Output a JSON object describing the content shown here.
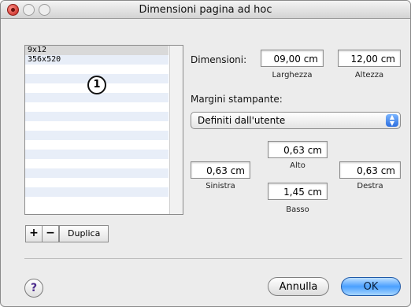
{
  "window": {
    "title": "Dimensioni pagina ad hoc"
  },
  "list": {
    "items": [
      "9x12",
      "356x520",
      "",
      "",
      "",
      "",
      "",
      "",
      "",
      "",
      "",
      "",
      "",
      "",
      "",
      "",
      ""
    ]
  },
  "callout": {
    "number": "1"
  },
  "list_buttons": {
    "add": "+",
    "remove": "−",
    "duplicate": "Duplica"
  },
  "dimensions": {
    "label": "Dimensioni:",
    "width_value": "09,00 cm",
    "height_value": "12,00 cm",
    "width_label": "Larghezza",
    "height_label": "Altezza"
  },
  "margins": {
    "label": "Margini stampante:",
    "popup_value": "Definiti dall'utente",
    "top_value": "0,63 cm",
    "top_label": "Alto",
    "left_value": "0,63 cm",
    "left_label": "Sinistra",
    "right_value": "0,63 cm",
    "right_label": "Destra",
    "bottom_value": "1,45 cm",
    "bottom_label": "Basso"
  },
  "footer": {
    "help": "?",
    "cancel": "Annulla",
    "ok": "OK"
  }
}
